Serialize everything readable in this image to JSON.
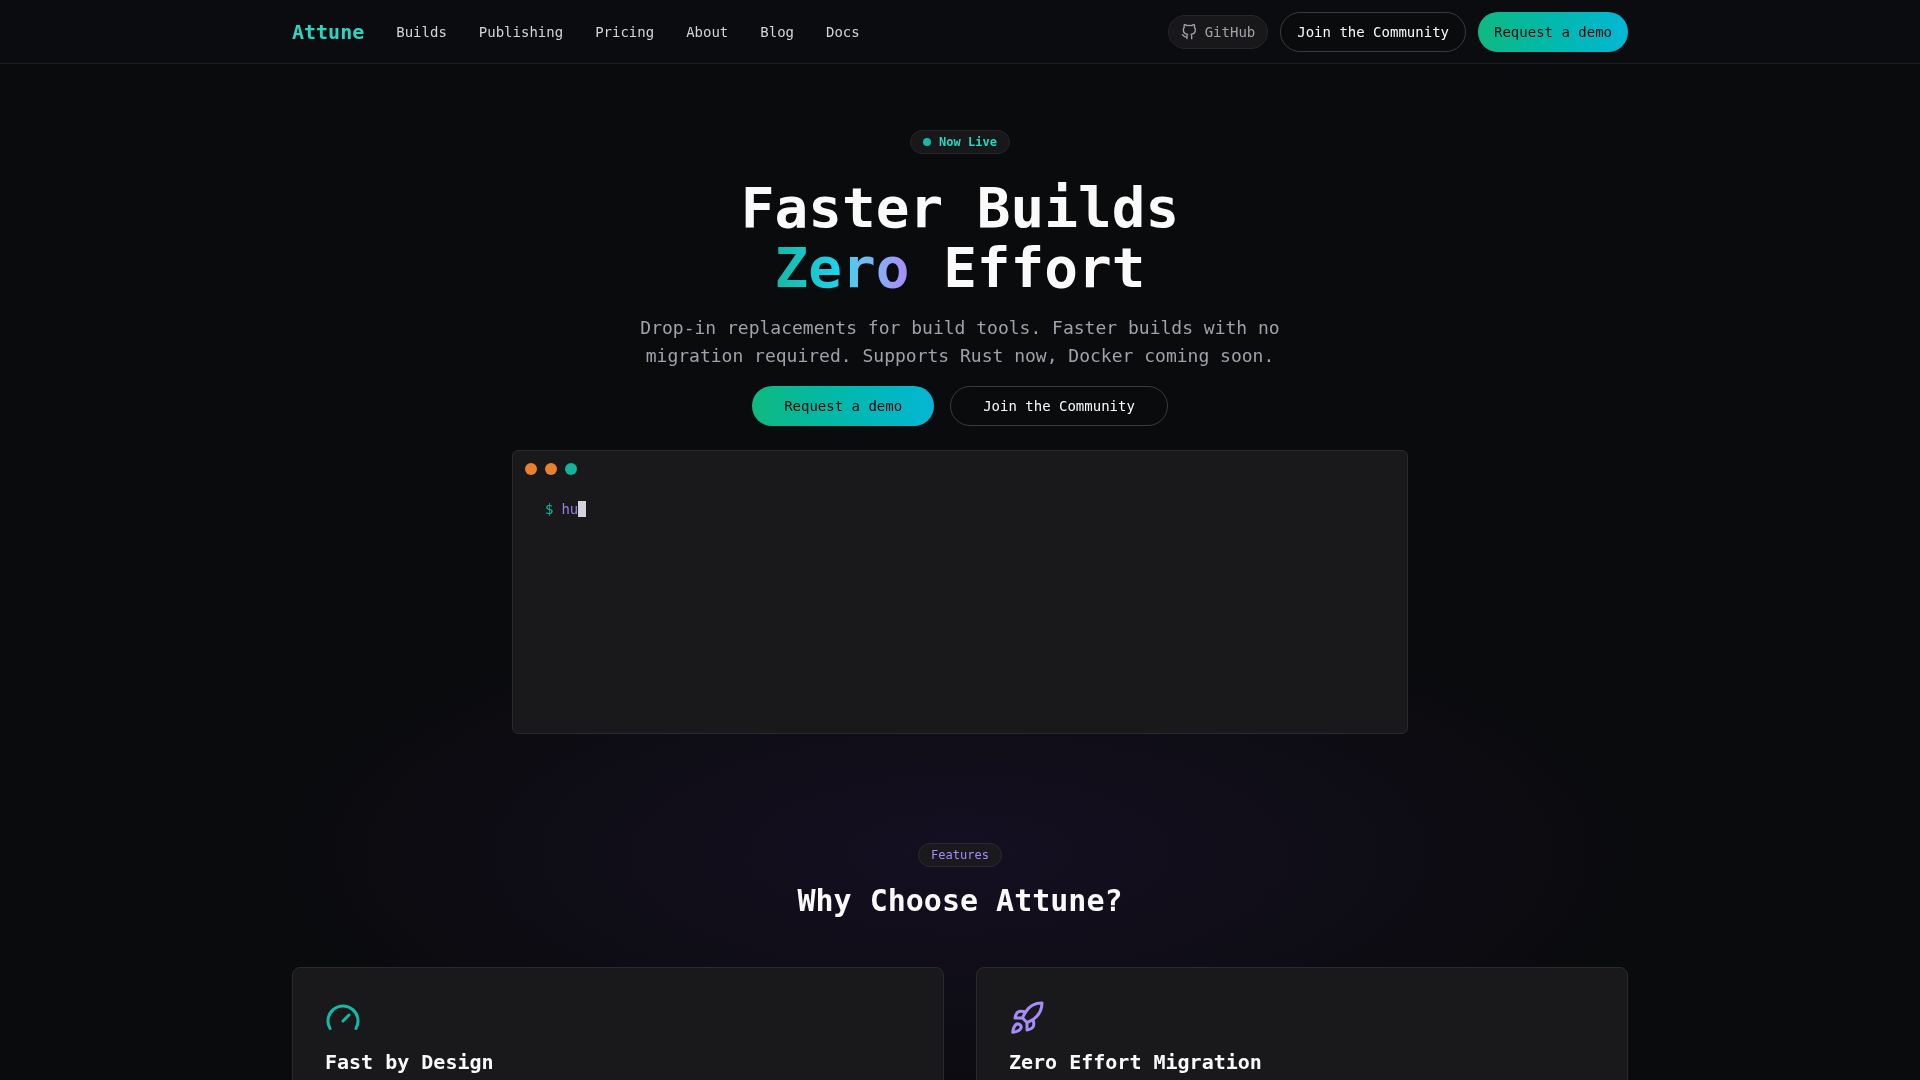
{
  "nav": {
    "logo": "Attune",
    "links": [
      {
        "label": "Builds"
      },
      {
        "label": "Publishing"
      },
      {
        "label": "Pricing"
      },
      {
        "label": "About"
      },
      {
        "label": "Blog"
      },
      {
        "label": "Docs"
      }
    ],
    "github": "GitHub",
    "community": "Join the Community",
    "demo": "Request a demo"
  },
  "hero": {
    "badge": "Now Live",
    "title": {
      "line_1": "Faster Builds",
      "highlight": "Zero",
      "rest": "Effort"
    },
    "description": "Drop-in replacements for build tools. Faster builds with no migration required. Supports Rust now, Docker coming soon.",
    "buttons": [
      {
        "kind": "primary",
        "label": "Request a demo"
      },
      {
        "kind": "secondary",
        "label": "Join the Community"
      }
    ]
  },
  "terminal": {
    "window_dots": [
      {
        "color": "#e8802e"
      },
      {
        "color": "#e8802e"
      },
      {
        "color": "#12b39a"
      }
    ],
    "prompt": "$",
    "input": "hu"
  },
  "features": {
    "badge": "Features",
    "heading": "Why Choose Attune?",
    "cards": [
      {
        "title": "Fast by Design",
        "color": "#14b8a6"
      },
      {
        "title": "Zero Effort Migration",
        "color": "#a78bfa"
      }
    ]
  }
}
